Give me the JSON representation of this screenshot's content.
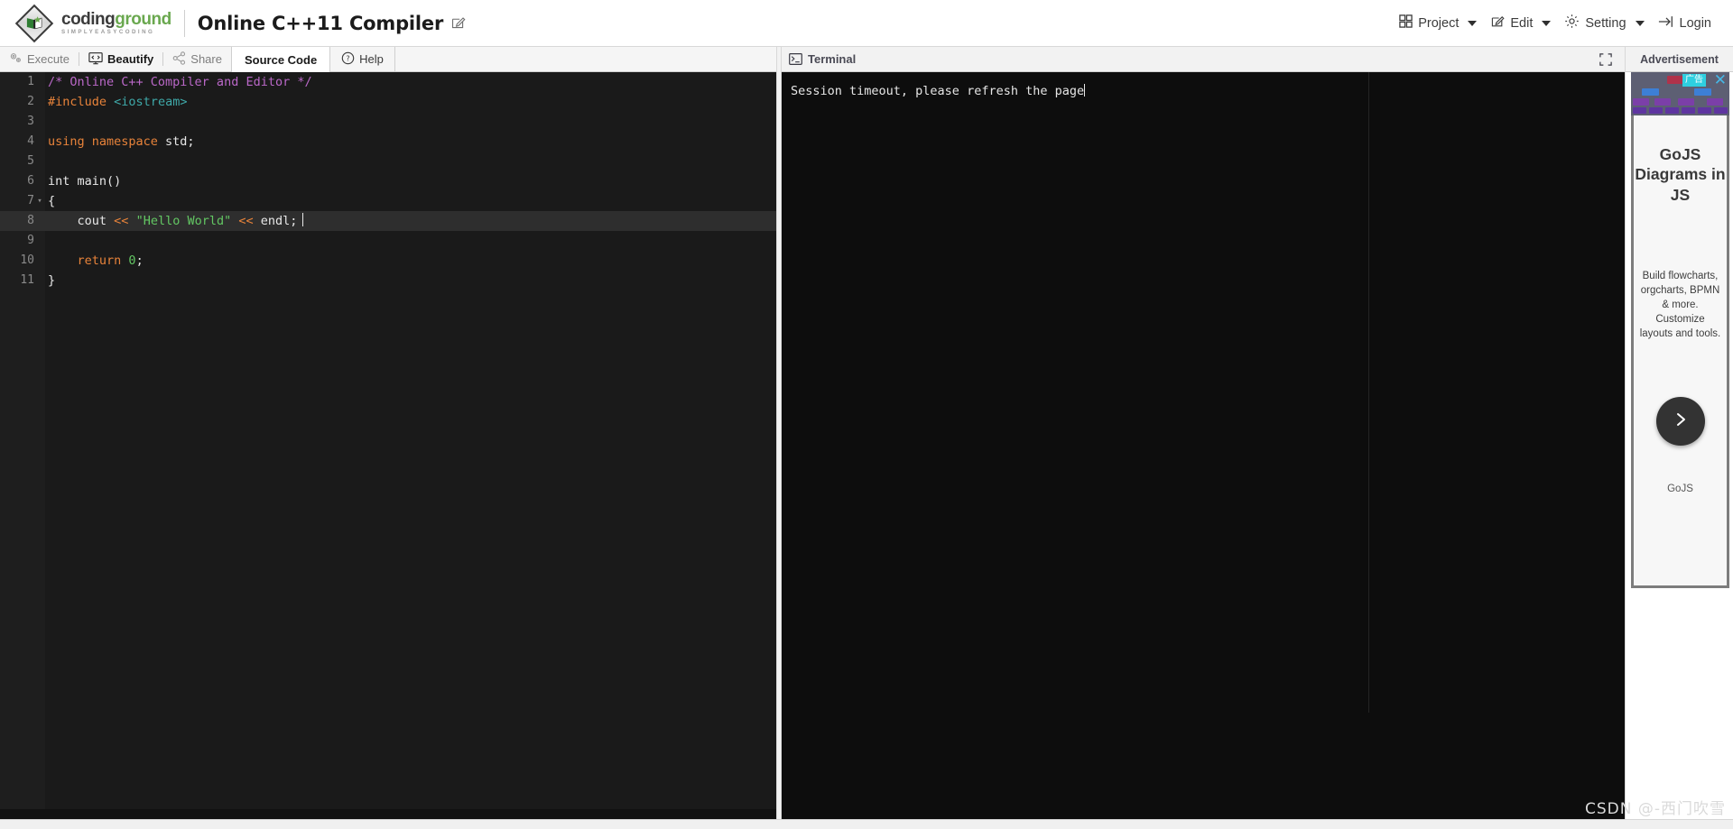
{
  "header": {
    "logo_main_dark": "coding",
    "logo_main_green": "ground",
    "logo_sub": "SIMPLYEASYCODING",
    "app_title": "Online C++11 Compiler",
    "edit_title_icon": "pencil-square-icon",
    "menu": [
      {
        "label": "Project",
        "icon": "grid-icon",
        "caret": true
      },
      {
        "label": "Edit",
        "icon": "pencil-square-icon",
        "caret": true
      },
      {
        "label": "Setting",
        "icon": "gear-icon",
        "caret": true
      },
      {
        "label": "Login",
        "icon": "login-arrow-icon",
        "caret": false
      }
    ]
  },
  "toolbar": {
    "execute": "Execute",
    "execute_icon": "gears-icon",
    "beautify": "Beautify",
    "beautify_icon": "code-monitor-icon",
    "share": "Share",
    "share_icon": "share-nodes-icon",
    "source_code_tab": "Source Code",
    "help": "Help",
    "help_icon": "question-circle-icon"
  },
  "editor": {
    "language": "cpp",
    "active_line": 8,
    "lines": [
      {
        "n": "1",
        "fold": "",
        "active": false,
        "tokens": [
          {
            "t": "comment",
            "v": "/* Online C++ Compiler and Editor */"
          }
        ]
      },
      {
        "n": "2",
        "fold": "",
        "active": false,
        "tokens": [
          {
            "t": "pre",
            "v": "#include"
          },
          {
            "t": "plain",
            "v": " "
          },
          {
            "t": "include",
            "v": "<iostream>"
          }
        ]
      },
      {
        "n": "3",
        "fold": "",
        "active": false,
        "tokens": []
      },
      {
        "n": "4",
        "fold": "",
        "active": false,
        "tokens": [
          {
            "t": "kw",
            "v": "using namespace"
          },
          {
            "t": "plain",
            "v": " std;"
          }
        ]
      },
      {
        "n": "5",
        "fold": "",
        "active": false,
        "tokens": []
      },
      {
        "n": "6",
        "fold": "",
        "active": false,
        "tokens": [
          {
            "t": "plain",
            "v": "int main()"
          }
        ]
      },
      {
        "n": "7",
        "fold": "▾",
        "active": false,
        "tokens": [
          {
            "t": "plain",
            "v": "{"
          }
        ]
      },
      {
        "n": "8",
        "fold": "",
        "active": true,
        "tokens": [
          {
            "t": "plain",
            "v": "    cout "
          },
          {
            "t": "op",
            "v": "<<"
          },
          {
            "t": "plain",
            "v": " "
          },
          {
            "t": "str",
            "v": "\"Hello World\""
          },
          {
            "t": "plain",
            "v": " "
          },
          {
            "t": "op",
            "v": "<<"
          },
          {
            "t": "plain",
            "v": " endl;"
          }
        ]
      },
      {
        "n": "9",
        "fold": "",
        "active": false,
        "tokens": []
      },
      {
        "n": "10",
        "fold": "",
        "active": false,
        "tokens": [
          {
            "t": "kw",
            "v": "    return"
          },
          {
            "t": "plain",
            "v": " "
          },
          {
            "t": "num",
            "v": "0"
          },
          {
            "t": "plain",
            "v": ";"
          }
        ]
      },
      {
        "n": "11",
        "fold": "",
        "active": false,
        "tokens": [
          {
            "t": "plain",
            "v": "}"
          }
        ]
      }
    ]
  },
  "terminal": {
    "title": "Terminal",
    "title_icon": "console-prompt-icon",
    "fullscreen_icon": "expand-icon",
    "output": "Session timeout, please refresh the page"
  },
  "ad": {
    "panel_title": "Advertisement",
    "badge": "广告",
    "close_icon": "close-icon",
    "headline": "GoJS Diagrams in JS",
    "copy": "Build flowcharts, orgcharts, BPMN & more. Customize layouts and tools.",
    "cta_icon": "chevron-right-icon",
    "brand": "GoJS"
  },
  "watermark": "CSDN @-西门吹雪",
  "colors": {
    "accent_green": "#6aa84f",
    "editor_bg": "#1a1a1a",
    "terminal_bg": "#0d0d0d",
    "comment": "#ba68c8",
    "string": "#63c763",
    "keyword": "#e8833a",
    "include": "#3fa9a9"
  }
}
